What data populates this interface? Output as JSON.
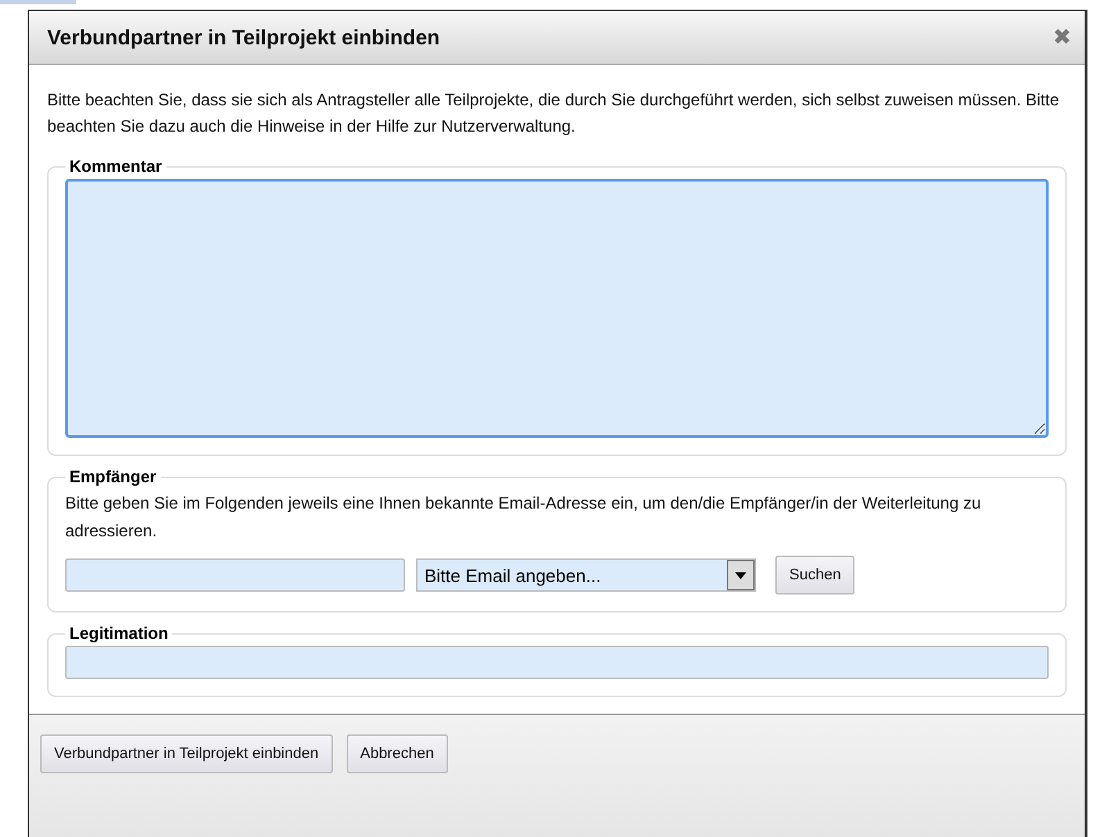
{
  "dialog": {
    "title": "Verbundpartner in Teilprojekt einbinden",
    "close": "✖"
  },
  "intro": "Bitte beachten Sie, dass sie sich als Antragsteller alle Teilprojekte, die durch Sie durchgeführt werden, sich selbst zuweisen müssen. Bitte beachten Sie dazu auch die Hinweise in der Hilfe zur Nutzerverwaltung.",
  "kommentar": {
    "legend": "Kommentar",
    "focused": true
  },
  "empfaenger": {
    "legend": "Empfänger",
    "text": "Bitte geben Sie im Folgenden jeweils eine Ihnen bekannte Email-Adresse ein, um den/die Empfänger/in der Weiterleitung zu adressieren.",
    "select": "Bitte Email angeben...",
    "search_button": "Suchen"
  },
  "legitimation": {
    "legend": "Legitimation"
  },
  "buttons": [
    "Verbundpartner in Teilprojekt einbinden",
    "Abbrechen"
  ]
}
